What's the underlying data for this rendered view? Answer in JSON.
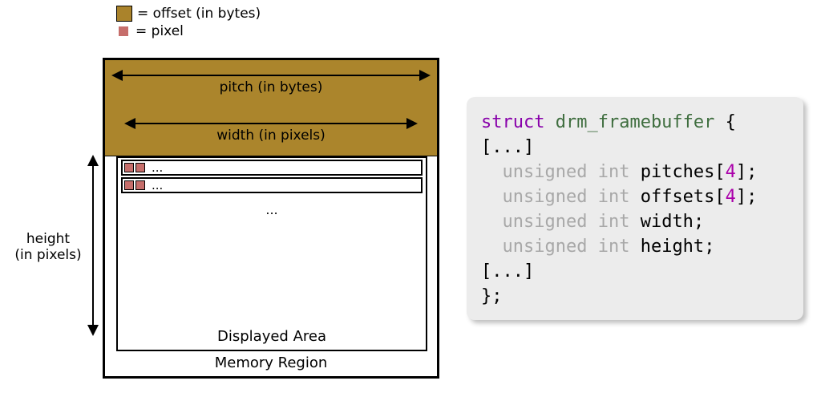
{
  "legend": {
    "offset_label": "= offset (in bytes)",
    "pixel_label": "= pixel"
  },
  "diagram": {
    "pitch_label": "pitch (in bytes)",
    "width_label": "width (in pixels)",
    "height_label_line1": "height",
    "height_label_line2": "(in pixels)",
    "scanline_dots": "...",
    "area_dots": "...",
    "displayed_area_label": "Displayed Area",
    "memory_region_label": "Memory Region"
  },
  "code": {
    "kw_struct": "struct",
    "struct_name": "drm_framebuffer",
    "open_brace": "{",
    "ellipsis": "[...]",
    "type_unsigned_int": "unsigned int",
    "field_pitches": "pitches",
    "field_offsets": "offsets",
    "field_width": "width",
    "field_height": "height",
    "array_dim": "4",
    "semicolon": ";",
    "close_brace": "};"
  },
  "colors": {
    "offset_fill": "#ab852c",
    "pixel_fill": "#c66e6b",
    "code_bg": "#ececec",
    "kw": "#8800aa",
    "type_gray": "#a8a8a8",
    "struct_name": "#3f6e3f",
    "number": "#aa00aa"
  }
}
